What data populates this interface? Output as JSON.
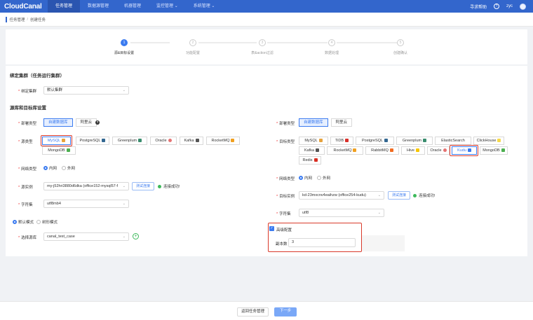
{
  "nav": {
    "logo": "CloudCanal",
    "items": [
      "任务管理",
      "数据源管理",
      "机器管理",
      "监控管理 ⌄",
      "系统管理 ⌄"
    ],
    "help": "寻求帮助",
    "user": "zyc"
  },
  "breadcrumb": {
    "parent": "任务管理",
    "current": "创建任务"
  },
  "steps": [
    {
      "num": "1",
      "label": "源&目标设置"
    },
    {
      "num": "2",
      "label": "功能配置"
    },
    {
      "num": "3",
      "label": "表&action过滤"
    },
    {
      "num": "4",
      "label": "数据处理"
    },
    {
      "num": "5",
      "label": "创建确认"
    }
  ],
  "cluster": {
    "section_title": "绑定集群（任务运行集群）",
    "label": "绑定集群",
    "value": "默认集群"
  },
  "db_section_title": "源库和目标库设置",
  "source": {
    "deploy_label": "部署类型",
    "deploy_options": [
      "自建数据库",
      "阿里云"
    ],
    "dbtype_label": "源类型",
    "db_types": [
      "MySQL",
      "PostgreSQL",
      "Greenplum",
      "Oracle",
      "Kafka",
      "RocketMQ",
      "MongoDB"
    ],
    "selected_db": "MySQL",
    "net_label": "网络类型",
    "net_options": [
      "内网",
      "外网"
    ],
    "instance_label": "源实例",
    "instance_value": "my-j52hri3880d6dka (office152-mysql57-f",
    "test_button": "测试连接",
    "conn_status": "连接成功!",
    "charset_label": "字符集",
    "charset_value": "utf8mb4",
    "mode_options": [
      "默认模式",
      "树形模式"
    ],
    "schema_label": "选择源库",
    "schema_value": "canal_test_case"
  },
  "target": {
    "deploy_label": "部署类型",
    "deploy_options": [
      "自建数据库",
      "阿里云"
    ],
    "dbtype_label": "目标类型",
    "db_types_row1": [
      "MySQL",
      "TiDB",
      "PostgreSQL",
      "Greenplum",
      "ElasticSearch",
      "ClickHouse"
    ],
    "db_types_row2": [
      "Kafka",
      "RocketMQ",
      "RabbitMQ",
      "Hive",
      "Oracle",
      "Kudu",
      "MongoDB"
    ],
    "db_types_row3": [
      "Redis"
    ],
    "selected_db": "Kudu",
    "net_label": "网络类型",
    "net_options": [
      "内网",
      "外网"
    ],
    "instance_label": "目标实例",
    "instance_value": "kd-23mxcnv4eaihzw (office254-kudu)",
    "test_button": "测试连接",
    "conn_status": "连接成功!",
    "charset_label": "字符集",
    "charset_value": "utf8",
    "advanced_label": "高级配置",
    "replica_label": "副本数",
    "replica_value": "3"
  },
  "footer": {
    "back_button": "返回任务管理",
    "next_button": "下一步"
  },
  "colors": {
    "nav": "#3366cc",
    "accent": "#3b7bf0",
    "highlight": "#d93a2b",
    "success": "#3cb95b"
  }
}
